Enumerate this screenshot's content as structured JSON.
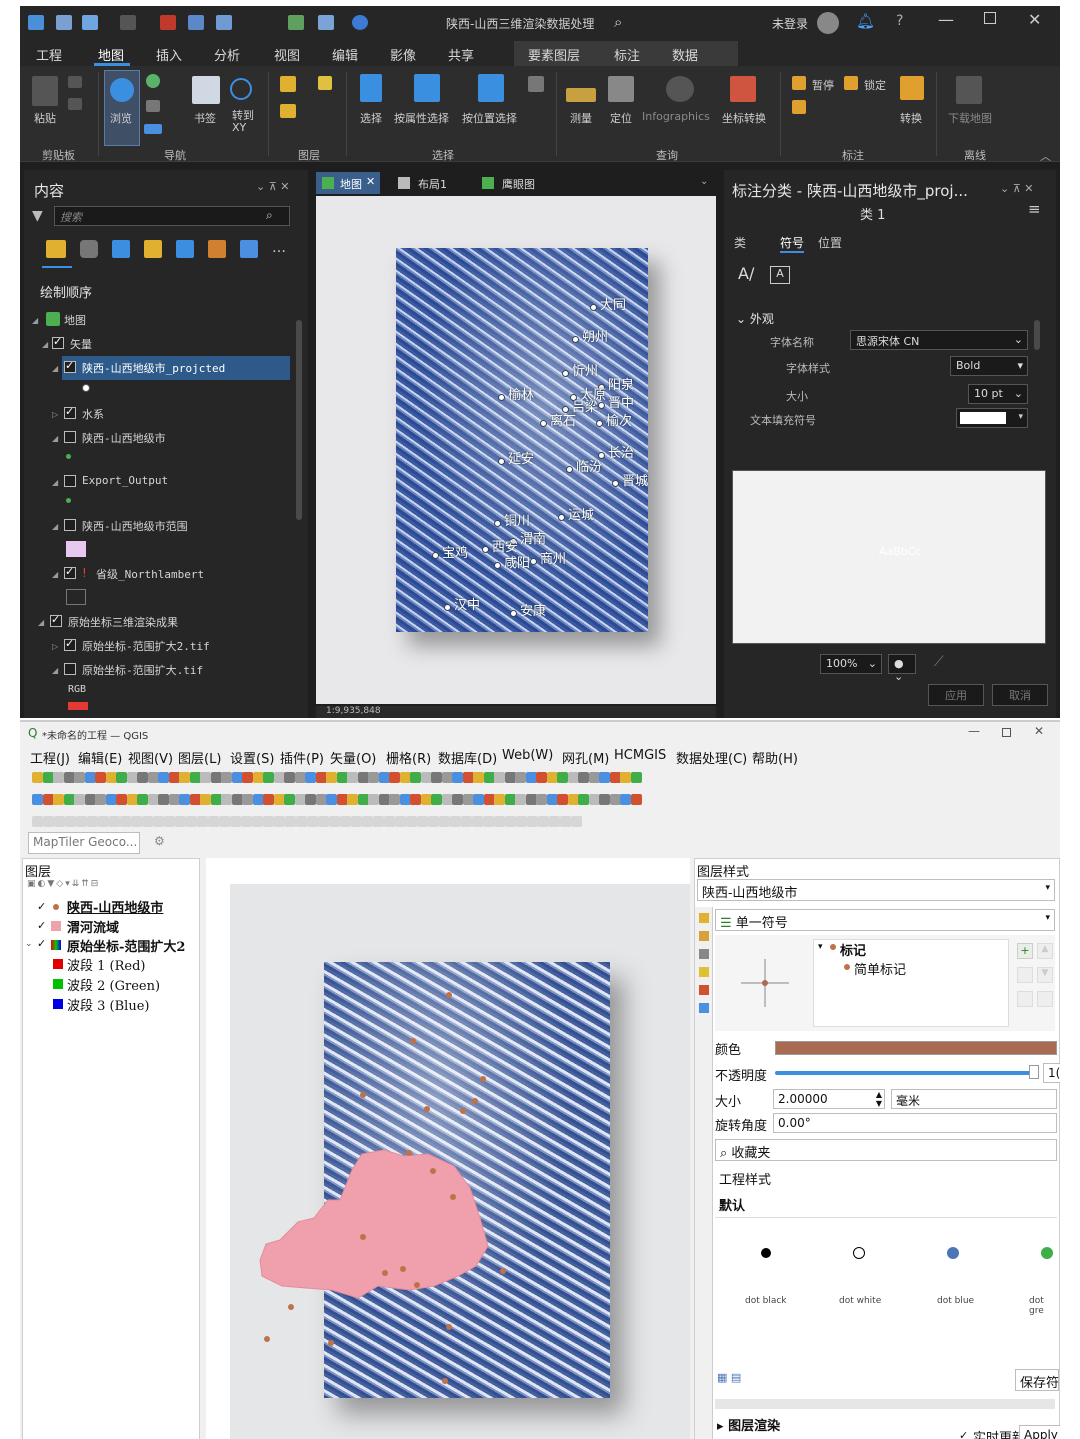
{
  "arcgis": {
    "window_title": "陕西-山西三维渲染数据处理",
    "user": "未登录",
    "menu_tabs": [
      "工程",
      "地图",
      "插入",
      "分析",
      "视图",
      "编辑",
      "影像",
      "共享",
      "要素图层",
      "标注",
      "数据"
    ],
    "ribbon": {
      "paste": "粘贴",
      "browse": "浏览",
      "bookmark": "书签",
      "goto": "转到\nXY",
      "select": "选择",
      "select_by_attr": "按属性选择",
      "select_by_loc": "按位置选择",
      "measure": "测量",
      "locate": "定位",
      "infographics": "Infographics",
      "coord_convert": "坐标转换",
      "pause": "暂停",
      "lock": "锁定",
      "convert": "转换",
      "download_map": "下载地图",
      "groups": [
        "剪贴板",
        "导航",
        "图层",
        "选择",
        "查询",
        "标注",
        "离线"
      ]
    },
    "contents": {
      "title": "内容",
      "search_placeholder": "搜索",
      "draw_order": "绘制顺序",
      "tree": [
        "地图",
        "矢量",
        "陕西-山西地级市_projcted",
        "水系",
        "陕西-山西地级市",
        "Export_Output",
        "陕西-山西地级市范围",
        "省级_Northlambert",
        "原始坐标三维渲染成果",
        "原始坐标-范围扩大2.tif",
        "原始坐标-范围扩大.tif",
        "RGB"
      ]
    },
    "map_tabs": [
      "地图",
      "布局1",
      "鹰眼图"
    ],
    "scale": "1:9,935,848",
    "cities": [
      "大同",
      "朔州",
      "忻州",
      "阳泉",
      "榆林",
      "太原",
      "晋中",
      "吕梁",
      "榆次",
      "离石",
      "延安",
      "长治",
      "临汾",
      "晋城",
      "运城",
      "铜川",
      "渭南",
      "西安",
      "咸阳",
      "宝鸡",
      "商州",
      "汉中",
      "安康"
    ],
    "label_panel": {
      "title": "标注分类 - 陕西-山西地级市_proj...",
      "class": "类 1",
      "tabs": [
        "类",
        "符号",
        "位置"
      ],
      "section": "外观",
      "font_name_label": "字体名称",
      "font_name": "思源宋体 CN",
      "font_style_label": "字体样式",
      "font_style": "Bold",
      "size_label": "大小",
      "size": "10 pt",
      "fill_label": "文本填充符号",
      "preview_text": "AaBbCc",
      "zoom": "100%",
      "apply": "应用",
      "cancel": "取消"
    }
  },
  "qgis": {
    "window_title": "*未命名的工程 — QGIS",
    "menus": [
      "工程(J)",
      "编辑(E)",
      "视图(V)",
      "图层(L)",
      "设置(S)",
      "插件(P)",
      "矢量(O)",
      "栅格(R)",
      "数据库(D)",
      "Web(W)",
      "网孔(M)",
      "HCMGIS",
      "数据处理(C)",
      "帮助(H)"
    ],
    "geocoder_placeholder": "MapTiler Geoco...",
    "layers_title": "图层",
    "layers": [
      "陕西-山西地级市",
      "渭河流域",
      "原始坐标-范围扩大2"
    ],
    "bands": [
      "波段 1 (Red)",
      "波段 2 (Green)",
      "波段 3 (Blue)"
    ],
    "band_colors": [
      "#e00000",
      "#00c000",
      "#0000e0"
    ],
    "style_title": "图层样式",
    "style_layer": "陕西-山西地级市",
    "renderer": "单一符号",
    "symbol_tree": [
      "标记",
      "简单标记"
    ],
    "color_label": "颜色",
    "symbol_color": "#a86a50",
    "opacity_label": "不透明度",
    "opacity_value": "1(",
    "size_label": "大小",
    "size_value": "2.00000",
    "size_unit": "毫米",
    "rotation_label": "旋转角度",
    "rotation_value": "0.00°",
    "favorites": "收藏夹",
    "project_styles": "工程样式",
    "default": "默认",
    "dots": [
      "dot black",
      "dot white",
      "dot blue",
      "dot gre"
    ],
    "save_btn": "保存符",
    "layer_render": "图层渲染",
    "live_update": "实时更新",
    "apply": "Apply"
  }
}
